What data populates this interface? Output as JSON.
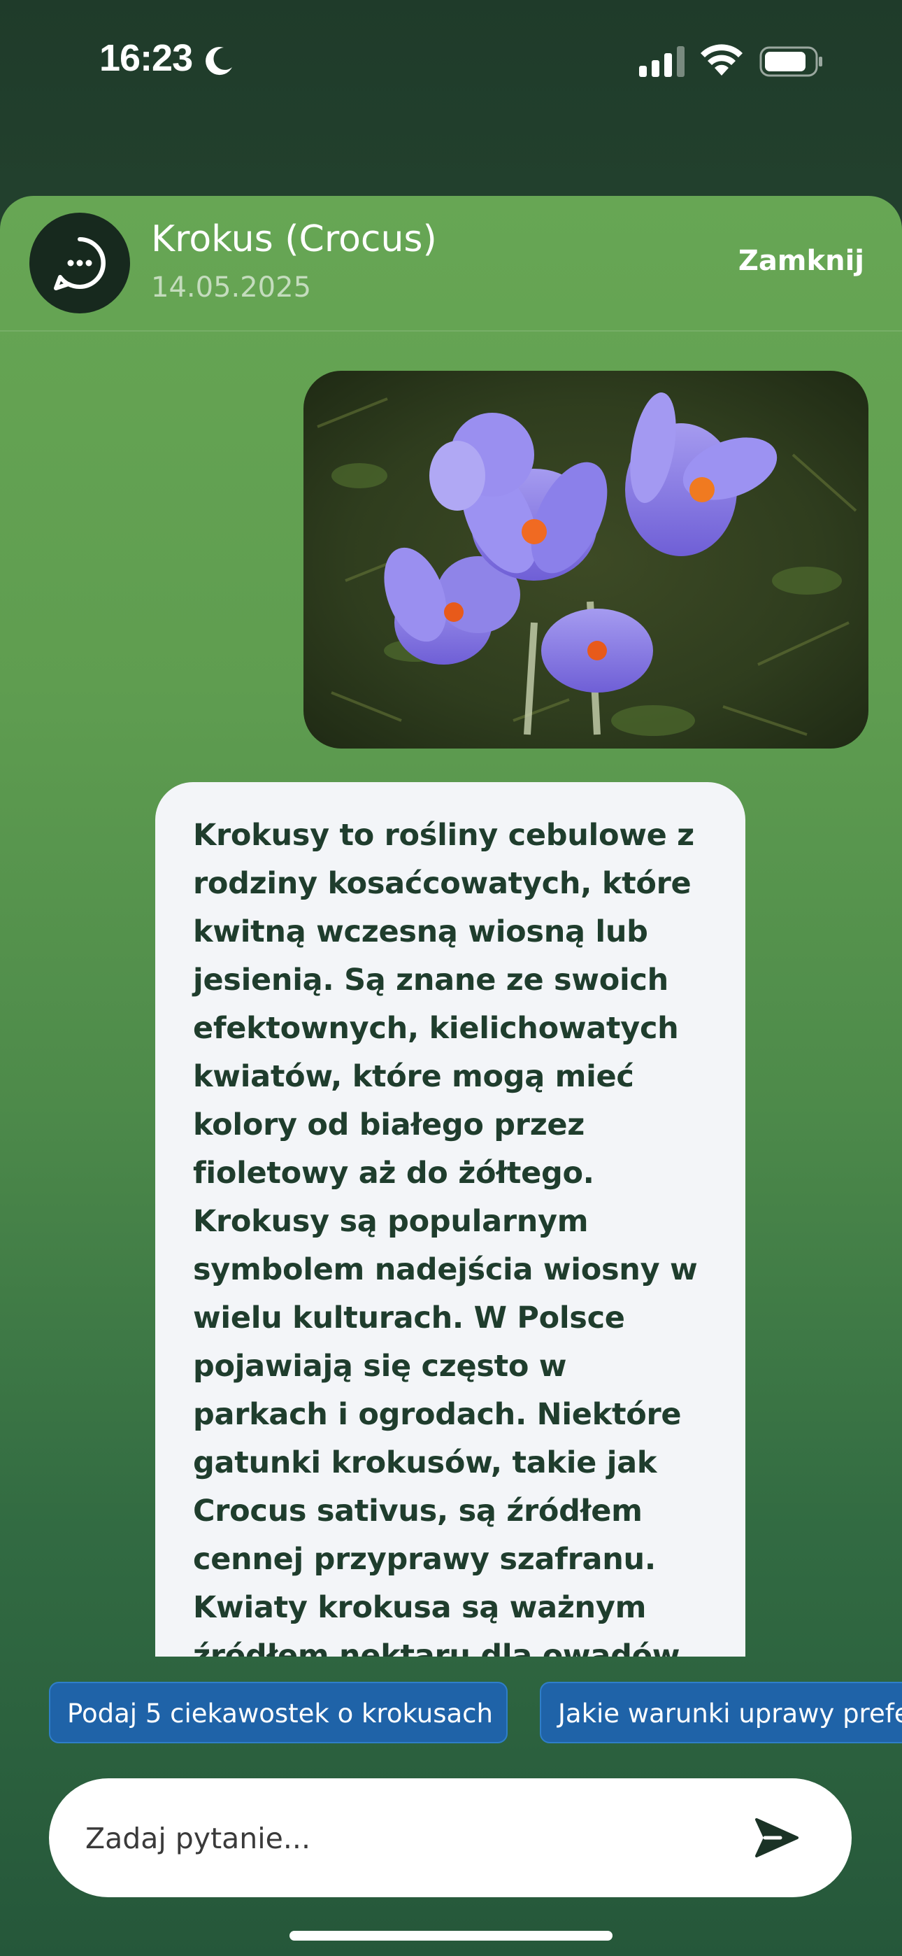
{
  "status_bar": {
    "time": "16:23",
    "icons": [
      "moon-icon",
      "cellular-signal-icon",
      "wifi-icon",
      "battery-icon"
    ]
  },
  "header": {
    "title": "Krokus (Crocus)",
    "date": "14.05.2025",
    "close_label": "Zamknij",
    "avatar_icon": "chat-bubble-icon"
  },
  "message": {
    "text": "Krokusy to rośliny cebulowe z rodziny kosaćcowatych, które kwitną wczesną wiosną lub jesienią. Są znane ze swoich efektownych, kielichowatych kwiatów, które mogą mieć kolory od białego przez fioletowy aż do żółtego. Krokusy są popularnym symbolem nadejścia wiosny w wielu kulturach. W Polsce pojawiają się często w parkach i ogrodach. Niektóre gatunki krokusów, takie jak Crocus sativus, są źródłem cennej przyprawy szafranu. Kwiaty krokusa są ważnym źródłem nektaru dla owadów."
  },
  "suggestions": [
    "Podaj 5 ciekawostek o krokusach",
    "Jakie warunki uprawy preferują krokusy?"
  ],
  "composer": {
    "placeholder": "Zadaj pytanie...",
    "send_icon": "send-icon"
  },
  "colors": {
    "sheet_green": "#67a654",
    "avatar_bg": "#17291e",
    "chip_blue": "#1f63a8",
    "bubble_bg": "#f3f5f8",
    "text_dark": "#1f3d2d"
  }
}
